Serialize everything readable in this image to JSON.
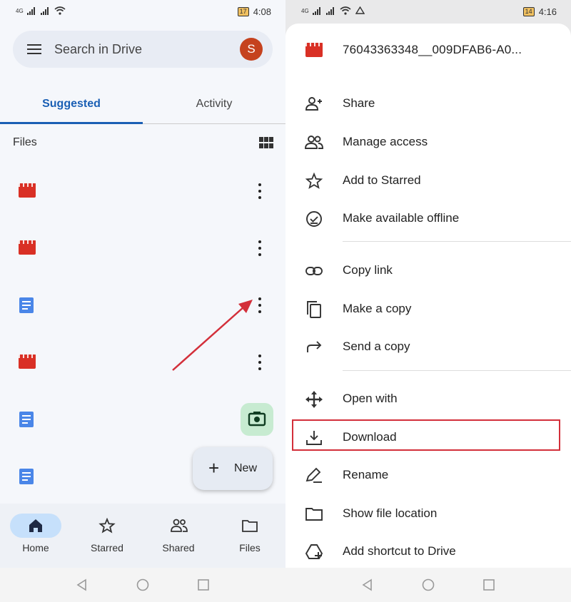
{
  "left": {
    "status": {
      "net": "4G",
      "time": "4:08",
      "battery": "17"
    },
    "search_placeholder": "Search in Drive",
    "avatar_letter": "S",
    "tabs": [
      {
        "label": "Suggested",
        "active": true
      },
      {
        "label": "Activity",
        "active": false
      }
    ],
    "files_label": "Files",
    "files": [
      {
        "type": "video",
        "icon": "video-file-icon"
      },
      {
        "type": "video",
        "icon": "video-file-icon"
      },
      {
        "type": "doc",
        "icon": "doc-file-icon"
      },
      {
        "type": "video",
        "icon": "video-file-icon"
      },
      {
        "type": "doc",
        "icon": "doc-file-icon"
      },
      {
        "type": "doc",
        "icon": "doc-file-icon"
      }
    ],
    "new_label": "New",
    "bottom_nav": [
      {
        "label": "Home",
        "icon": "home-icon",
        "active": true
      },
      {
        "label": "Starred",
        "icon": "star-icon",
        "active": false
      },
      {
        "label": "Shared",
        "icon": "shared-icon",
        "active": false
      },
      {
        "label": "Files",
        "icon": "folder-icon",
        "active": false
      }
    ]
  },
  "right": {
    "status": {
      "net": "4G",
      "time": "4:16",
      "battery": "14"
    },
    "file_title": "76043363348__009DFAB6-A0...",
    "menu": [
      {
        "label": "Share",
        "icon": "add-person-icon"
      },
      {
        "label": "Manage access",
        "icon": "people-icon"
      },
      {
        "label": "Add to Starred",
        "icon": "star-icon"
      },
      {
        "label": "Make available offline",
        "icon": "offline-check-icon"
      },
      {
        "label": "Copy link",
        "icon": "link-icon"
      },
      {
        "label": "Make a copy",
        "icon": "copy-icon"
      },
      {
        "label": "Send a copy",
        "icon": "send-icon"
      },
      {
        "label": "Open with",
        "icon": "open-with-icon"
      },
      {
        "label": "Download",
        "icon": "download-icon",
        "highlighted": true
      },
      {
        "label": "Rename",
        "icon": "rename-icon"
      },
      {
        "label": "Show file location",
        "icon": "folder-icon"
      },
      {
        "label": "Add shortcut to Drive",
        "icon": "add-shortcut-icon"
      }
    ]
  },
  "colors": {
    "accent": "#1a5fb4",
    "highlight_box": "#d32f3a",
    "annotation_arrow": "#d32f3a",
    "avatar": "#c5421e"
  }
}
